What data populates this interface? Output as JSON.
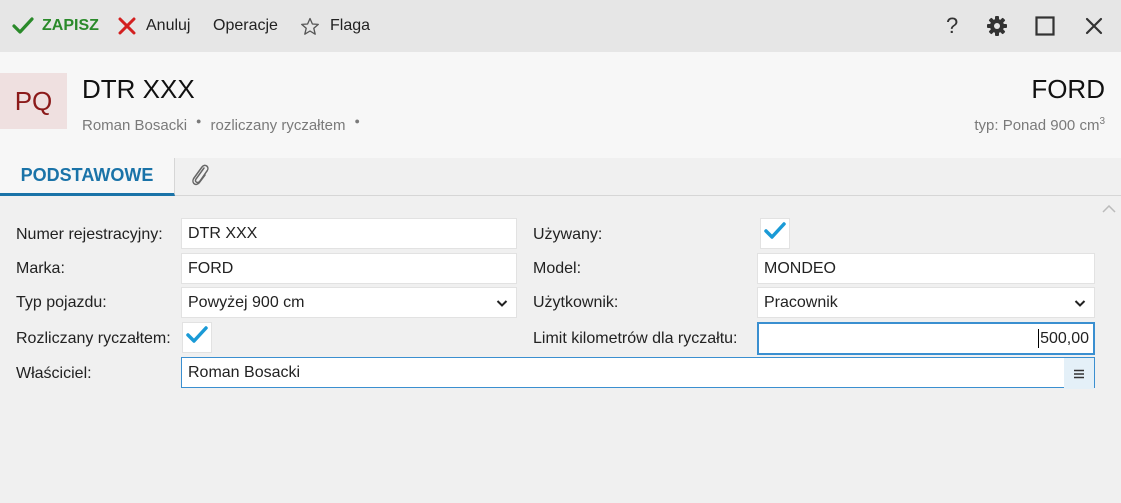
{
  "toolbar": {
    "save_label": "ZAPISZ",
    "cancel_label": "Anuluj",
    "operations_label": "Operacje",
    "flag_label": "Flaga",
    "help_label": "?"
  },
  "header": {
    "avatar_initials": "PQ",
    "title": "DTR XXX",
    "owner": "Roman Bosacki",
    "settlement": "rozliczany ryczałtem",
    "brand": "FORD",
    "type_prefix": "typ: Ponad 900 cm",
    "type_sup": "3"
  },
  "tabs": {
    "main_label": "PODSTAWOWE"
  },
  "form": {
    "reg_label": "Numer rejestracyjny:",
    "reg_value": "DTR XXX",
    "brand_label": "Marka:",
    "brand_value": "FORD",
    "vehicle_type_label": "Typ pojazdu:",
    "vehicle_type_value": "Powyżej 900 cm",
    "lump_label": "Rozliczany ryczałtem:",
    "owner_label": "Właściciel:",
    "owner_value": "Roman Bosacki",
    "used_label": "Używany:",
    "model_label": "Model:",
    "model_value": "MONDEO",
    "user_label": "Użytkownik:",
    "user_value": "Pracownik",
    "limit_label": "Limit kilometrów dla ryczałtu:",
    "limit_value": "500,00"
  },
  "colors": {
    "accent": "#1a73a8",
    "save_green": "#2a8a2a",
    "cancel_red": "#d32020",
    "check_blue": "#1a9ad6",
    "avatar_bg": "#efe0e0",
    "avatar_fg": "#8b1a1a"
  },
  "icons": {
    "save": "checkmark-icon",
    "cancel": "x-icon",
    "flag": "star-outline-icon",
    "help": "question-icon",
    "settings": "gear-icon",
    "maximize": "square-icon",
    "close": "close-icon",
    "attachments": "paperclip-icon",
    "lookup": "menu-lines-icon"
  }
}
